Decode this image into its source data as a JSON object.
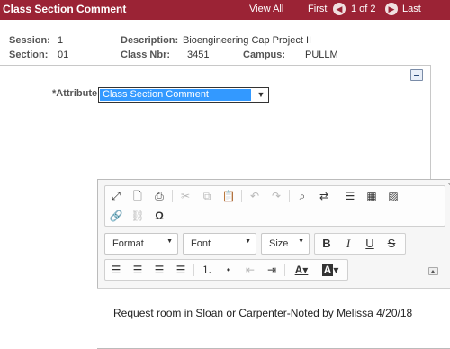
{
  "header": {
    "title": "Class Section Comment",
    "view_all": "View All",
    "first": "First",
    "page_count": "1 of 2",
    "last": "Last"
  },
  "info": {
    "session_label": "Session:",
    "session_value": "1",
    "description_label": "Description:",
    "description_value": "Bioengineering Cap Project II",
    "section_label": "Section:",
    "section_value": "01",
    "class_nbr_label": "Class Nbr:",
    "class_nbr_value": "3451",
    "campus_label": "Campus:",
    "campus_value": "PULLM"
  },
  "attribute": {
    "label": "*Attribute",
    "selected": "Class Section Comment"
  },
  "toolbar": {
    "format_label": "Format",
    "font_label": "Font",
    "size_label": "Size"
  },
  "editor": {
    "content": "Request room in Sloan or Carpenter-Noted by Melissa 4/20/18"
  },
  "colors": {
    "header_bg": "#9b2335",
    "selection": "#3399ff"
  }
}
